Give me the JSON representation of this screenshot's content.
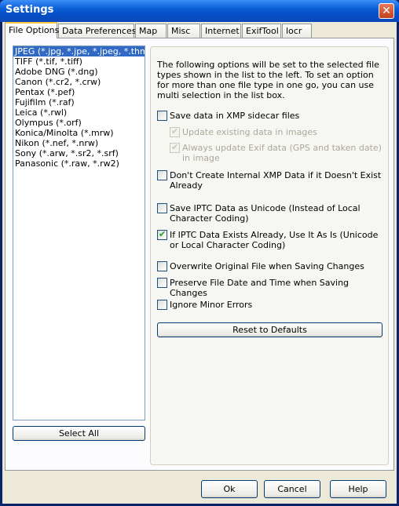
{
  "window": {
    "title": "Settings",
    "close_glyph": "✕"
  },
  "tabs": [
    {
      "label": "File Options",
      "active": true
    },
    {
      "label": "Data Preferences"
    },
    {
      "label": "Map"
    },
    {
      "label": "Misc"
    },
    {
      "label": "Internet"
    },
    {
      "label": "ExifTool"
    },
    {
      "label": "locr"
    }
  ],
  "file_types": [
    {
      "label": "JPEG (*.jpg, *.jpe, *.jpeg, *.thm)",
      "selected": true
    },
    {
      "label": "TIFF (*.tif, *.tiff)"
    },
    {
      "label": "Adobe DNG (*.dng)"
    },
    {
      "label": "Canon (*.cr2, *.crw)"
    },
    {
      "label": "Pentax (*.pef)"
    },
    {
      "label": "Fujifilm (*.raf)"
    },
    {
      "label": "Leica (*.rwl)"
    },
    {
      "label": "Olympus (*.orf)"
    },
    {
      "label": "Konica/Minolta (*.mrw)"
    },
    {
      "label": "Nikon (*.nef, *.nrw)"
    },
    {
      "label": "Sony (*.arw, *.sr2, *.srf)"
    },
    {
      "label": "Panasonic (*.raw, *.rw2)"
    }
  ],
  "select_all_label": "Select All",
  "description": "The following options will be set to the selected file types shown in the list to the left. To set an option for more than one file type in one go, you can use multi selection in the list box.",
  "options": {
    "xmp_sidecar": {
      "label": "Save data in XMP sidecar files",
      "checked": false
    },
    "update_existing": {
      "label": "Update existing data in images",
      "checked": true,
      "disabled": true
    },
    "always_update_exif": {
      "label": "Always update Exif data (GPS and taken date) in image",
      "checked": true,
      "disabled": true
    },
    "no_internal_xmp": {
      "label": "Don't Create Internal XMP Data if it Doesn't Exist Already",
      "checked": false
    },
    "iptc_unicode": {
      "label": "Save IPTC Data as Unicode (Instead of Local Character Coding)",
      "checked": false
    },
    "iptc_as_is": {
      "label": "If IPTC Data Exists Already, Use It As Is (Unicode or Local Character Coding)",
      "checked": true
    },
    "overwrite_original": {
      "label": "Overwrite Original File when Saving Changes",
      "checked": false
    },
    "preserve_date": {
      "label": "Preserve File Date and Time when Saving Changes",
      "checked": false
    },
    "ignore_minor": {
      "label": "Ignore Minor Errors",
      "checked": false
    }
  },
  "reset_label": "Reset to Defaults",
  "footer": {
    "ok": "Ok",
    "cancel": "Cancel",
    "help": "Help"
  },
  "check_glyph": "✔"
}
